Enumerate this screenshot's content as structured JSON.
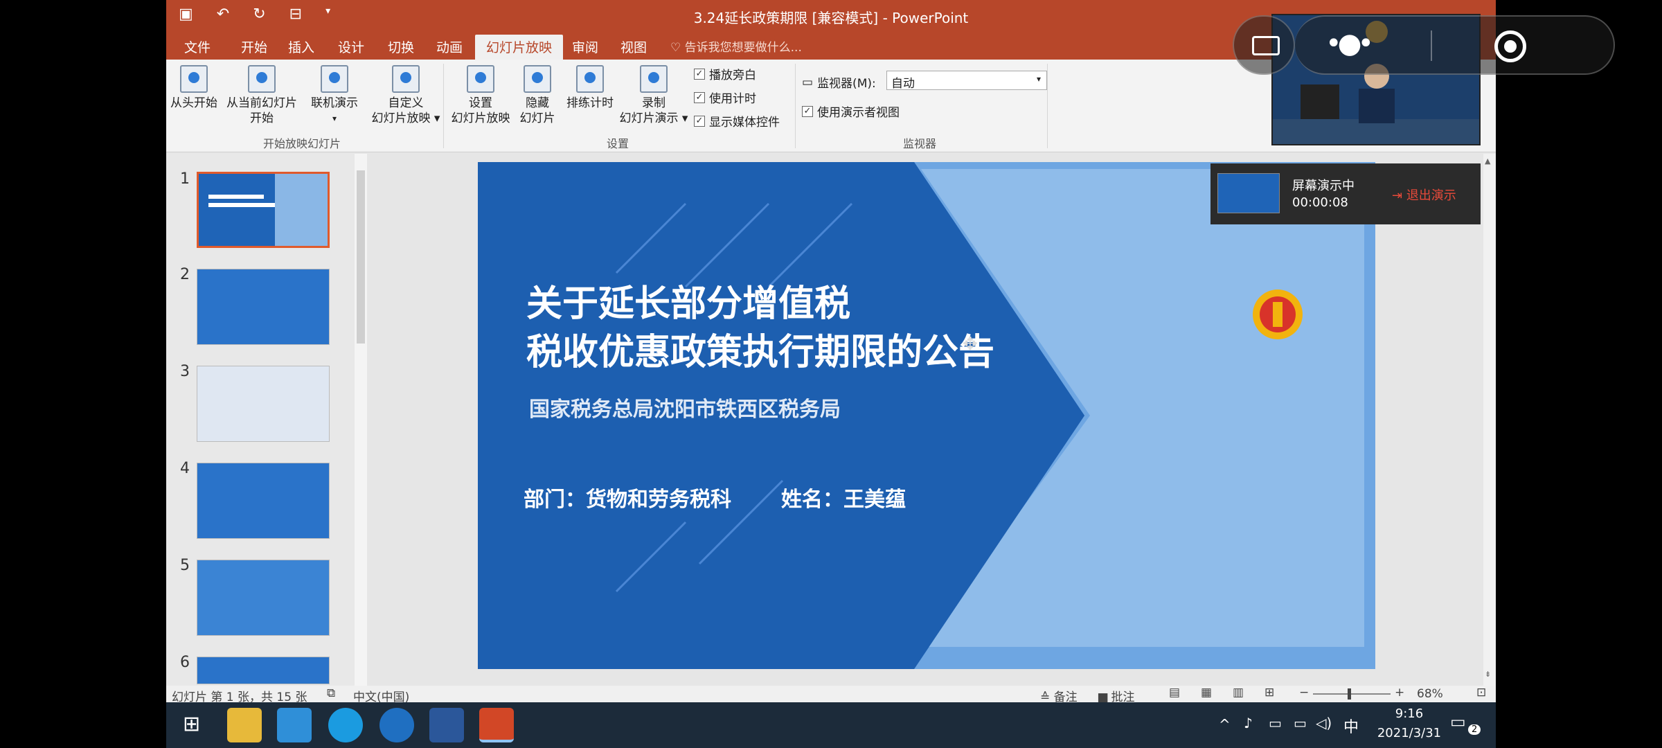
{
  "window": {
    "title": "3.24延长政策期限 [兼容模式] - PowerPoint",
    "qat": [
      "save-icon",
      "undo-icon",
      "redo-icon",
      "present-icon",
      "more-icon"
    ]
  },
  "tabs": [
    "文件",
    "开始",
    "插入",
    "设计",
    "切换",
    "动画",
    "幻灯片放映",
    "审阅",
    "视图"
  ],
  "active_tab": "幻灯片放映",
  "tell_me": "告诉我您想要做什么...",
  "ribbon": {
    "group_start": {
      "label": "开始放映幻灯片",
      "buttons": [
        {
          "line1": "从头开始",
          "line2": ""
        },
        {
          "line1": "从当前幻灯片",
          "line2": "开始"
        },
        {
          "line1": "联机演示",
          "line2": "▾"
        },
        {
          "line1": "自定义",
          "line2": "幻灯片放映 ▾"
        }
      ]
    },
    "group_setup": {
      "label": "设置",
      "buttons": [
        {
          "line1": "设置",
          "line2": "幻灯片放映"
        },
        {
          "line1": "隐藏",
          "line2": "幻灯片"
        },
        {
          "line1": "排练计时",
          "line2": ""
        },
        {
          "line1": "录制",
          "line2": "幻灯片演示 ▾"
        }
      ],
      "checkboxes": [
        "播放旁白",
        "使用计时",
        "显示媒体控件"
      ]
    },
    "group_monitor": {
      "label": "监视器",
      "monitor_label": "监视器(M):",
      "monitor_value": "自动",
      "presenter_view": "使用演示者视图"
    }
  },
  "thumbnails": [
    "1",
    "2",
    "3",
    "4",
    "5",
    "6"
  ],
  "slide": {
    "title_line1": "关于延长部分增值税",
    "title_line2": "税收优惠政策执行期限的公告",
    "org": "国家税务总局沈阳市铁西区税务局",
    "dept": "部门：货物和劳务税科",
    "name": "姓名：王美蕴"
  },
  "screen_share": {
    "status": "屏幕演示中",
    "timer": "00:00:08",
    "exit": "退出演示"
  },
  "statusbar": {
    "slide_info": "幻灯片 第 1 张，共 15 张",
    "language": "中文(中国)",
    "notes": "备注",
    "comments": "批注",
    "zoom": "68%"
  },
  "taskbar": {
    "time": "9:16",
    "date": "2021/3/31",
    "ime": "中",
    "notif_count": "2"
  },
  "colors": {
    "accent": "#b7472a",
    "slide_blue": "#1f64b7"
  }
}
